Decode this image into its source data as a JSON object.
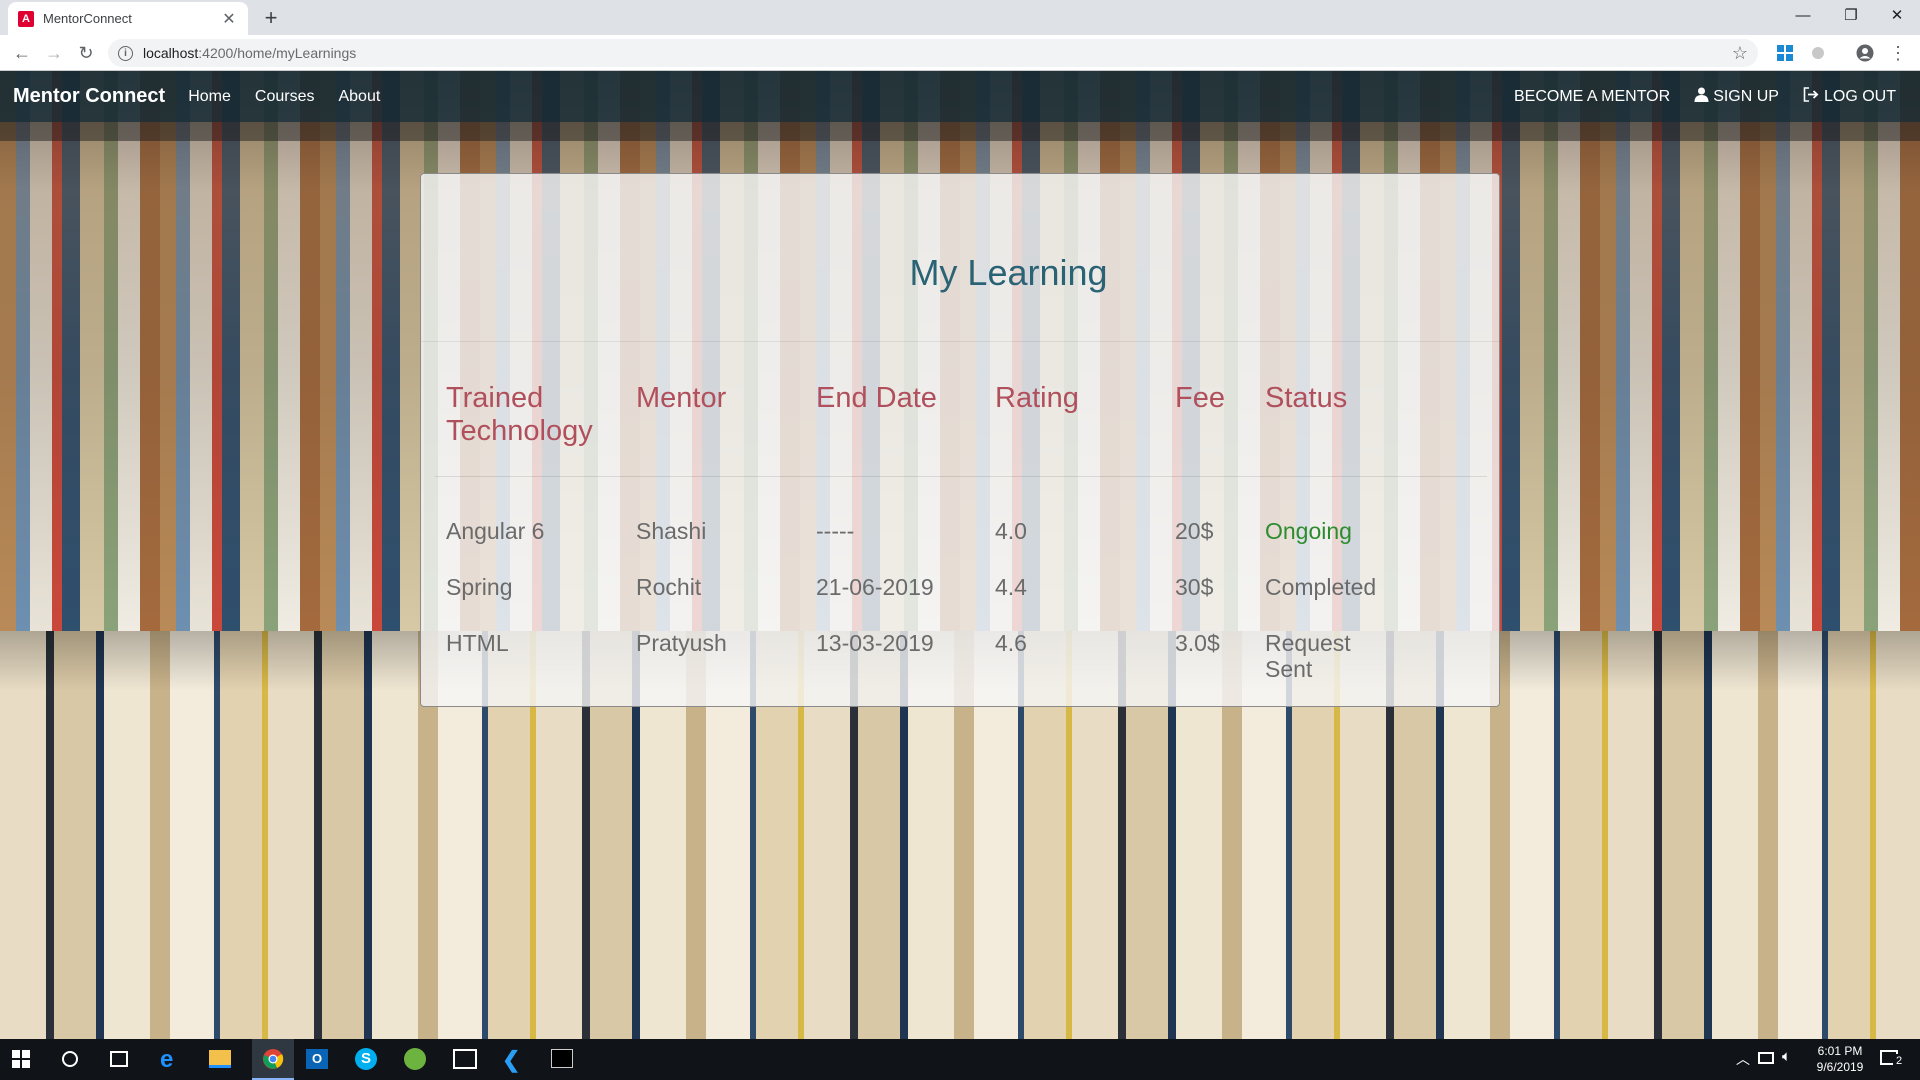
{
  "browser": {
    "tab_title": "MentorConnect",
    "tab_favicon": "A",
    "url_host": "localhost",
    "url_path": ":4200/home/myLearnings"
  },
  "navbar": {
    "brand": "Mentor Connect",
    "links": [
      "Home",
      "Courses",
      "About"
    ],
    "become_mentor": "BECOME A MENTOR",
    "sign_up": "SIGN UP",
    "log_out": "LOG OUT"
  },
  "learning": {
    "title": "My Learning",
    "columns": [
      "Trained Technology",
      "Mentor",
      "End Date",
      "Rating",
      "Fee",
      "Status"
    ],
    "rows": [
      {
        "technology": "Angular 6",
        "mentor": "Shashi",
        "end_date": "-----",
        "rating": "4.0",
        "fee": "20$",
        "status": "Ongoing"
      },
      {
        "technology": "Spring",
        "mentor": "Rochit",
        "end_date": "21-06-2019",
        "rating": "4.4",
        "fee": "30$",
        "status": "Completed"
      },
      {
        "technology": "HTML",
        "mentor": "Pratyush",
        "end_date": "13-03-2019",
        "rating": "4.6",
        "fee": "3.0$",
        "status": "Request Sent"
      }
    ]
  },
  "taskbar": {
    "time": "6:01 PM",
    "date": "9/6/2019",
    "notification_count": "2"
  },
  "colors": {
    "header_text": "#b0505c",
    "title_text": "#2a6375",
    "ongoing_status": "#2e8b2e"
  }
}
